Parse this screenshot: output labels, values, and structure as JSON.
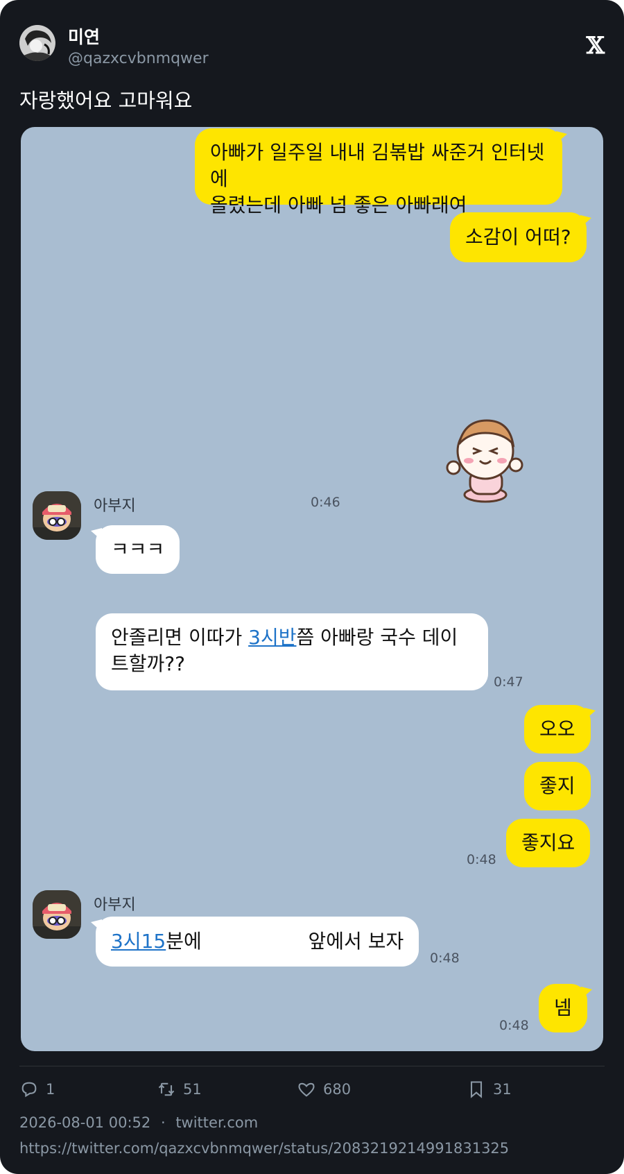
{
  "user": {
    "display_name": "미연",
    "handle": "@qazxcvbnmqwer"
  },
  "brand": {
    "logo": "𝕏"
  },
  "tweet": {
    "text": "자랑했어요 고마워요"
  },
  "chat": {
    "messages": [
      {
        "text": "아빠가 일주일 내내 김볶밥 싸준거 인터넷에"
      },
      {
        "text": "올렸는데 아빠 넘 좋은 아빠래여"
      },
      {
        "text": "소감이 어떠?"
      },
      {
        "time": "0:46"
      },
      {
        "sender": "아부지"
      },
      {
        "text": "ㅋㅋㅋ"
      },
      {
        "text_a": "안졸리면 이따가 ",
        "link": "3시반",
        "text_b": "쯤 아빠랑 국수 데이",
        "text_c": "트할까??"
      },
      {
        "time": "0:47"
      },
      {
        "text": "오오"
      },
      {
        "text": "좋지"
      },
      {
        "text": "좋지요",
        "time": "0:48"
      },
      {
        "sender": "아부지"
      },
      {
        "link": "3시15",
        "text_a": "분에 ",
        "text_b": " 앞에서 보자",
        "time": "0:48"
      },
      {
        "text": "넴",
        "time": "0:48"
      }
    ]
  },
  "stats": {
    "replies": "1",
    "retweets": "51",
    "likes": "680",
    "bookmarks": "31"
  },
  "meta": {
    "date": "2026-08-01 00:52",
    "separator": "·",
    "source": "twitter.com",
    "url": "https://twitter.com/qazxcvbnmqwer/status/2083219214991831325"
  },
  "colors": {
    "background": "#15181e",
    "chat_background": "#a9bdd1",
    "my_bubble": "#fee500",
    "other_bubble": "#ffffff",
    "link": "#1e73c8"
  },
  "icons": [
    "x-logo-icon",
    "reply-icon",
    "retweet-icon",
    "like-icon",
    "bookmark-icon"
  ]
}
